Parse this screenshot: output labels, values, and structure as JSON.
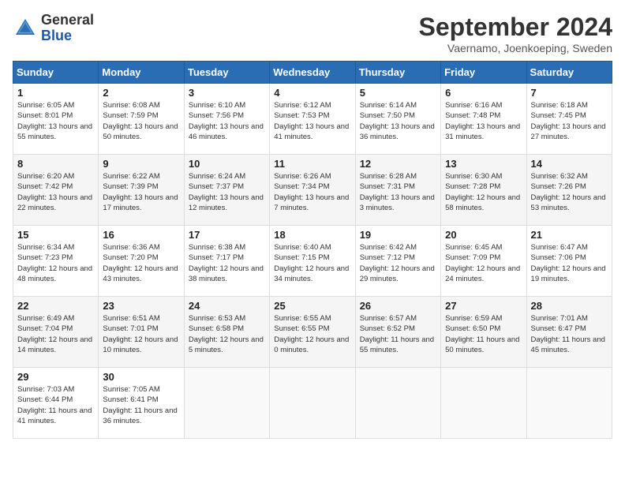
{
  "logo": {
    "text_general": "General",
    "text_blue": "Blue"
  },
  "header": {
    "month": "September 2024",
    "location": "Vaernamo, Joenkoeping, Sweden"
  },
  "days_of_week": [
    "Sunday",
    "Monday",
    "Tuesday",
    "Wednesday",
    "Thursday",
    "Friday",
    "Saturday"
  ],
  "weeks": [
    [
      {
        "day": "1",
        "sunrise": "6:05 AM",
        "sunset": "8:01 PM",
        "daylight": "13 hours and 55 minutes."
      },
      {
        "day": "2",
        "sunrise": "6:08 AM",
        "sunset": "7:59 PM",
        "daylight": "13 hours and 50 minutes."
      },
      {
        "day": "3",
        "sunrise": "6:10 AM",
        "sunset": "7:56 PM",
        "daylight": "13 hours and 46 minutes."
      },
      {
        "day": "4",
        "sunrise": "6:12 AM",
        "sunset": "7:53 PM",
        "daylight": "13 hours and 41 minutes."
      },
      {
        "day": "5",
        "sunrise": "6:14 AM",
        "sunset": "7:50 PM",
        "daylight": "13 hours and 36 minutes."
      },
      {
        "day": "6",
        "sunrise": "6:16 AM",
        "sunset": "7:48 PM",
        "daylight": "13 hours and 31 minutes."
      },
      {
        "day": "7",
        "sunrise": "6:18 AM",
        "sunset": "7:45 PM",
        "daylight": "13 hours and 27 minutes."
      }
    ],
    [
      {
        "day": "8",
        "sunrise": "6:20 AM",
        "sunset": "7:42 PM",
        "daylight": "13 hours and 22 minutes."
      },
      {
        "day": "9",
        "sunrise": "6:22 AM",
        "sunset": "7:39 PM",
        "daylight": "13 hours and 17 minutes."
      },
      {
        "day": "10",
        "sunrise": "6:24 AM",
        "sunset": "7:37 PM",
        "daylight": "13 hours and 12 minutes."
      },
      {
        "day": "11",
        "sunrise": "6:26 AM",
        "sunset": "7:34 PM",
        "daylight": "13 hours and 7 minutes."
      },
      {
        "day": "12",
        "sunrise": "6:28 AM",
        "sunset": "7:31 PM",
        "daylight": "13 hours and 3 minutes."
      },
      {
        "day": "13",
        "sunrise": "6:30 AM",
        "sunset": "7:28 PM",
        "daylight": "12 hours and 58 minutes."
      },
      {
        "day": "14",
        "sunrise": "6:32 AM",
        "sunset": "7:26 PM",
        "daylight": "12 hours and 53 minutes."
      }
    ],
    [
      {
        "day": "15",
        "sunrise": "6:34 AM",
        "sunset": "7:23 PM",
        "daylight": "12 hours and 48 minutes."
      },
      {
        "day": "16",
        "sunrise": "6:36 AM",
        "sunset": "7:20 PM",
        "daylight": "12 hours and 43 minutes."
      },
      {
        "day": "17",
        "sunrise": "6:38 AM",
        "sunset": "7:17 PM",
        "daylight": "12 hours and 38 minutes."
      },
      {
        "day": "18",
        "sunrise": "6:40 AM",
        "sunset": "7:15 PM",
        "daylight": "12 hours and 34 minutes."
      },
      {
        "day": "19",
        "sunrise": "6:42 AM",
        "sunset": "7:12 PM",
        "daylight": "12 hours and 29 minutes."
      },
      {
        "day": "20",
        "sunrise": "6:45 AM",
        "sunset": "7:09 PM",
        "daylight": "12 hours and 24 minutes."
      },
      {
        "day": "21",
        "sunrise": "6:47 AM",
        "sunset": "7:06 PM",
        "daylight": "12 hours and 19 minutes."
      }
    ],
    [
      {
        "day": "22",
        "sunrise": "6:49 AM",
        "sunset": "7:04 PM",
        "daylight": "12 hours and 14 minutes."
      },
      {
        "day": "23",
        "sunrise": "6:51 AM",
        "sunset": "7:01 PM",
        "daylight": "12 hours and 10 minutes."
      },
      {
        "day": "24",
        "sunrise": "6:53 AM",
        "sunset": "6:58 PM",
        "daylight": "12 hours and 5 minutes."
      },
      {
        "day": "25",
        "sunrise": "6:55 AM",
        "sunset": "6:55 PM",
        "daylight": "12 hours and 0 minutes."
      },
      {
        "day": "26",
        "sunrise": "6:57 AM",
        "sunset": "6:52 PM",
        "daylight": "11 hours and 55 minutes."
      },
      {
        "day": "27",
        "sunrise": "6:59 AM",
        "sunset": "6:50 PM",
        "daylight": "11 hours and 50 minutes."
      },
      {
        "day": "28",
        "sunrise": "7:01 AM",
        "sunset": "6:47 PM",
        "daylight": "11 hours and 45 minutes."
      }
    ],
    [
      {
        "day": "29",
        "sunrise": "7:03 AM",
        "sunset": "6:44 PM",
        "daylight": "11 hours and 41 minutes."
      },
      {
        "day": "30",
        "sunrise": "7:05 AM",
        "sunset": "6:41 PM",
        "daylight": "11 hours and 36 minutes."
      },
      null,
      null,
      null,
      null,
      null
    ]
  ]
}
